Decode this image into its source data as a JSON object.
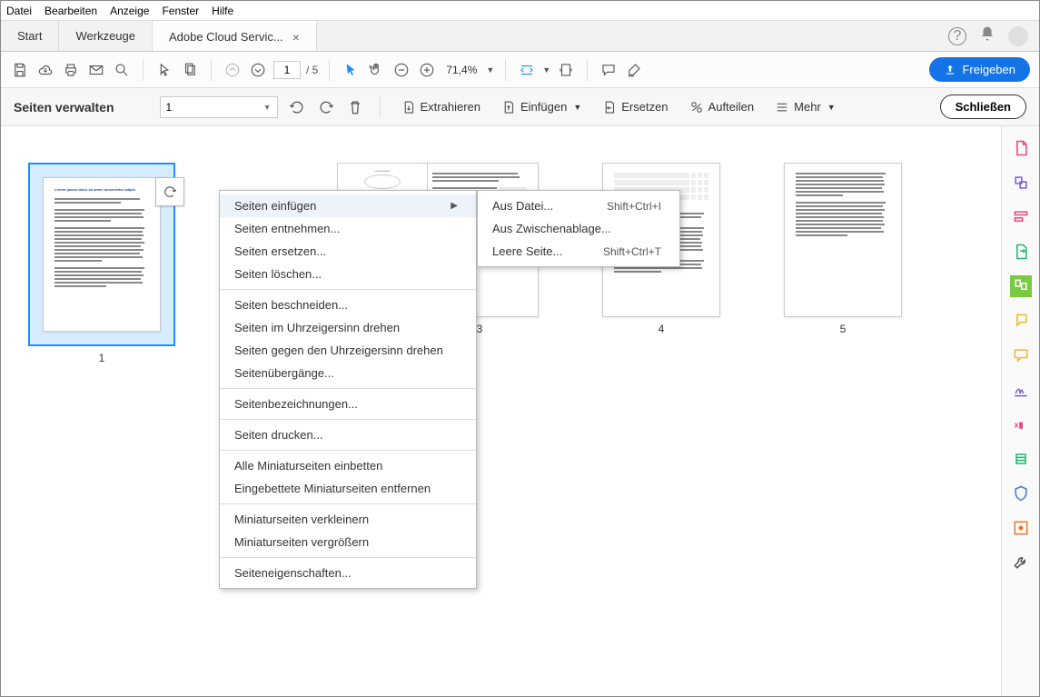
{
  "menubar": [
    "Datei",
    "Bearbeiten",
    "Anzeige",
    "Fenster",
    "Hilfe"
  ],
  "tabs": {
    "start": "Start",
    "tools": "Werkzeuge",
    "doc": "Adobe Cloud Servic..."
  },
  "toolbar": {
    "page_current": "1",
    "page_total": "/  5",
    "zoom": "71,4%",
    "share": "Freigeben"
  },
  "secondary": {
    "title": "Seiten verwalten",
    "page_sel": "1",
    "extract": "Extrahieren",
    "insert": "Einfügen",
    "replace": "Ersetzen",
    "split": "Aufteilen",
    "more": "Mehr",
    "close": "Schließen"
  },
  "thumbs": [
    "1",
    "3",
    "4",
    "5"
  ],
  "context_menu": {
    "items1": [
      "Seiten einfügen",
      "Seiten entnehmen...",
      "Seiten ersetzen...",
      "Seiten löschen..."
    ],
    "items2": [
      "Seiten beschneiden...",
      "Seiten im Uhrzeigersinn drehen",
      "Seiten gegen den Uhrzeigersinn drehen",
      "Seitenübergänge..."
    ],
    "items3": [
      "Seitenbezeichnungen..."
    ],
    "items4": [
      "Seiten drucken..."
    ],
    "items5": [
      "Alle Miniaturseiten einbetten",
      "Eingebettete Miniaturseiten entfernen"
    ],
    "items6": [
      "Miniaturseiten verkleinern",
      "Miniaturseiten vergrößern"
    ],
    "items7": [
      "Seiteneigenschaften..."
    ]
  },
  "submenu": {
    "items": [
      {
        "label": "Aus Datei...",
        "shortcut": "Shift+Ctrl+I"
      },
      {
        "label": "Aus Zwischenablage...",
        "shortcut": ""
      },
      {
        "label": "Leere Seite...",
        "shortcut": "Shift+Ctrl+T"
      }
    ]
  }
}
